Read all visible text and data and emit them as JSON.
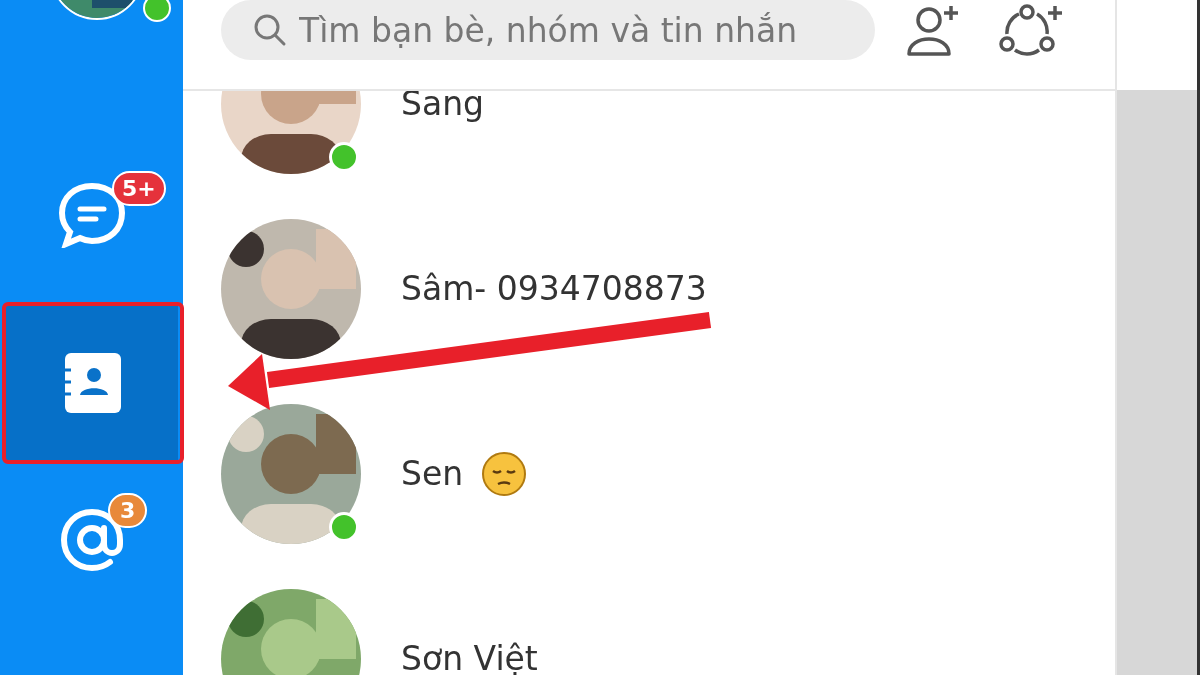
{
  "sidebar": {
    "profile": {
      "online": true
    },
    "items": [
      {
        "kind": "chat",
        "selected": false,
        "badge": "5+",
        "color": "#e5323b"
      },
      {
        "kind": "contacts",
        "selected": true
      },
      {
        "kind": "mention",
        "selected": false,
        "badge": "3",
        "color": "#e8893a"
      }
    ]
  },
  "search": {
    "placeholder": "Tìm bạn bè, nhóm và tin nhắn"
  },
  "contacts": [
    {
      "name": "Sang",
      "online": true,
      "has_emoji": false
    },
    {
      "name": "Sâm- 0934708873",
      "online": false,
      "has_emoji": false
    },
    {
      "name": "Sen",
      "online": true,
      "has_emoji": true
    },
    {
      "name": "Sơn Việt",
      "online": false,
      "has_emoji": false
    }
  ]
}
